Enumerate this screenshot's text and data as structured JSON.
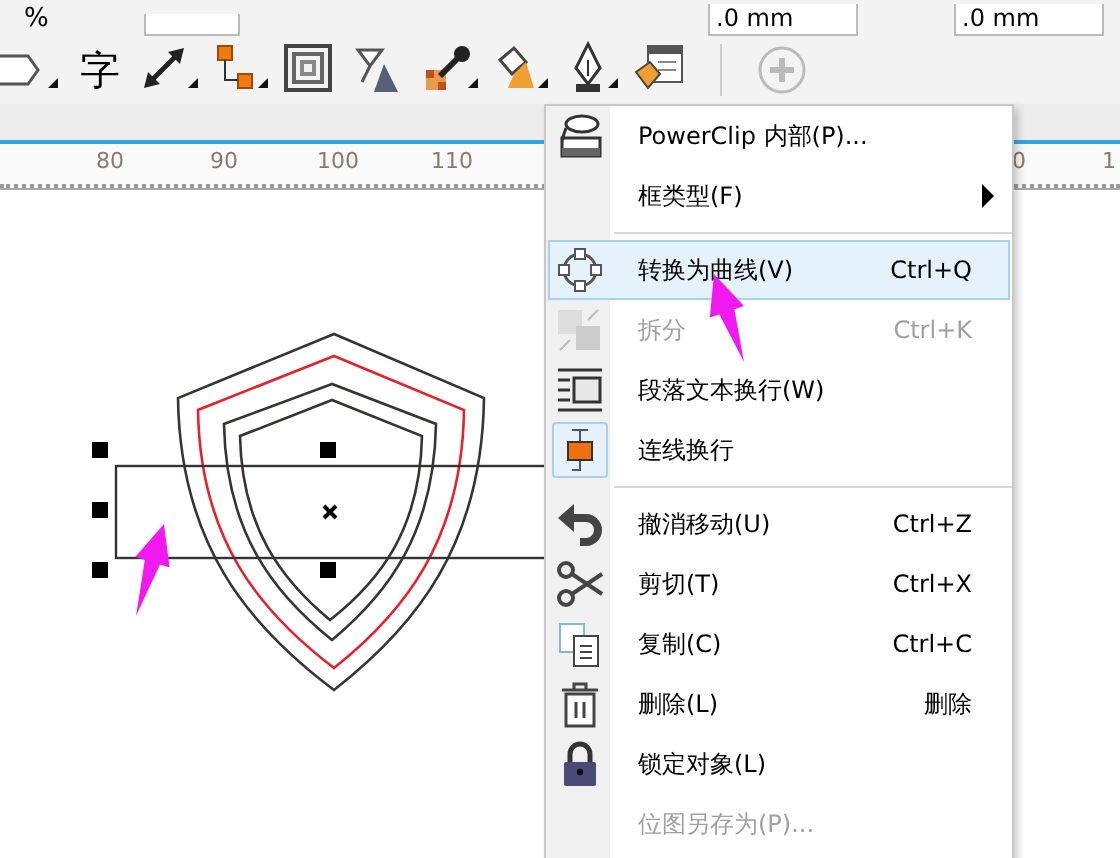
{
  "toolbar_top": {
    "percent": "%",
    "fields": [
      {
        "value": ".0 mm"
      },
      {
        "value": ".0 mm"
      }
    ]
  },
  "toolbar": {
    "text_tool_glyph": "字"
  },
  "ruler": {
    "labels": [
      "80",
      "90",
      "100",
      "110"
    ],
    "cut_labels": [
      "0",
      "1"
    ]
  },
  "context_menu": {
    "items": [
      {
        "kind": "item",
        "label": "PowerClip 内部(P)...",
        "selected": false,
        "disabled": false,
        "checked": false,
        "submenu": false
      },
      {
        "kind": "item",
        "label": "框类型(F)",
        "selected": false,
        "disabled": false,
        "checked": false,
        "submenu": true
      },
      {
        "kind": "separator"
      },
      {
        "kind": "item",
        "label": "转换为曲线(V)",
        "shortcut": "Ctrl+Q",
        "selected": true,
        "disabled": false,
        "checked": false,
        "submenu": false
      },
      {
        "kind": "item",
        "label": "拆分",
        "shortcut": "Ctrl+K",
        "selected": false,
        "disabled": true,
        "checked": false,
        "submenu": false
      },
      {
        "kind": "item",
        "label": "段落文本换行(W)",
        "selected": false,
        "disabled": false,
        "checked": false,
        "submenu": false
      },
      {
        "kind": "item",
        "label": "连线换行",
        "selected": false,
        "disabled": false,
        "checked": true,
        "submenu": false
      },
      {
        "kind": "separator"
      },
      {
        "kind": "item",
        "label": "撤消移动(U)",
        "shortcut": "Ctrl+Z",
        "selected": false,
        "disabled": false,
        "checked": false,
        "submenu": false
      },
      {
        "kind": "item",
        "label": "剪切(T)",
        "shortcut": "Ctrl+X",
        "selected": false,
        "disabled": false,
        "checked": false,
        "submenu": false
      },
      {
        "kind": "item",
        "label": "复制(C)",
        "shortcut": "Ctrl+C",
        "selected": false,
        "disabled": false,
        "checked": false,
        "submenu": false
      },
      {
        "kind": "item",
        "label": "删除(L)",
        "shortcut": "删除",
        "selected": false,
        "disabled": false,
        "checked": false,
        "submenu": false
      },
      {
        "kind": "item",
        "label": "锁定对象(L)",
        "selected": false,
        "disabled": false,
        "checked": false,
        "submenu": false
      },
      {
        "kind": "item",
        "label": "位图另存为(P)...",
        "selected": false,
        "disabled": true,
        "checked": false,
        "submenu": false
      }
    ]
  }
}
